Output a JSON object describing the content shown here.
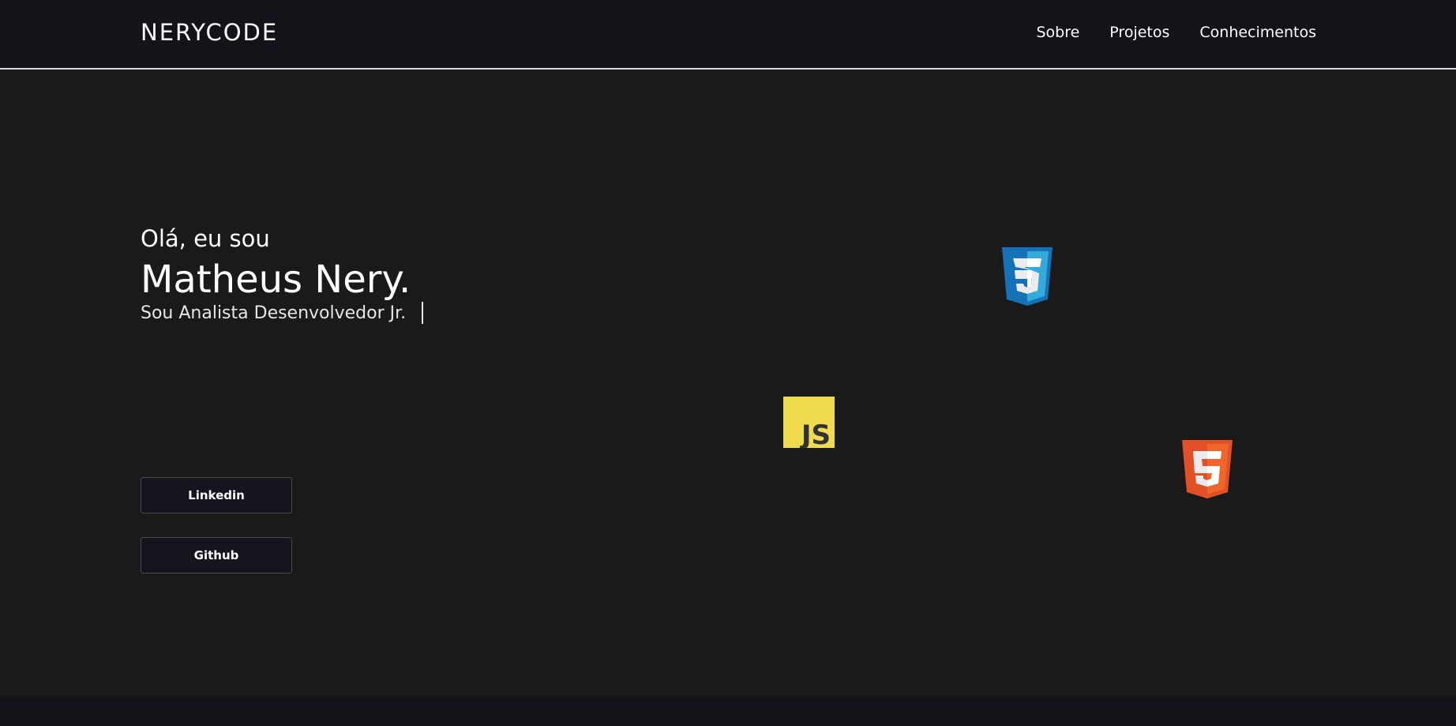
{
  "header": {
    "brand": "NERYCODE",
    "nav": [
      {
        "label": "Sobre"
      },
      {
        "label": "Projetos"
      },
      {
        "label": "Conhecimentos"
      }
    ]
  },
  "hero": {
    "greeting": "Olá, eu sou",
    "name": "Matheus Nery.",
    "role": "Sou Analista Desenvolvedor Jr."
  },
  "buttons": {
    "linkedin": "Linkedin",
    "github": "Github"
  },
  "logos": {
    "css": {
      "icon": "css3-logo-icon",
      "color": "#1572b6"
    },
    "js": {
      "icon": "javascript-logo-icon",
      "text": "JS",
      "color": "#f0db4f"
    },
    "html": {
      "icon": "html5-logo-icon",
      "color": "#e34f26"
    }
  },
  "colors": {
    "background": "#1a1a1b",
    "header": "#13131a",
    "text": "#ffffff"
  }
}
